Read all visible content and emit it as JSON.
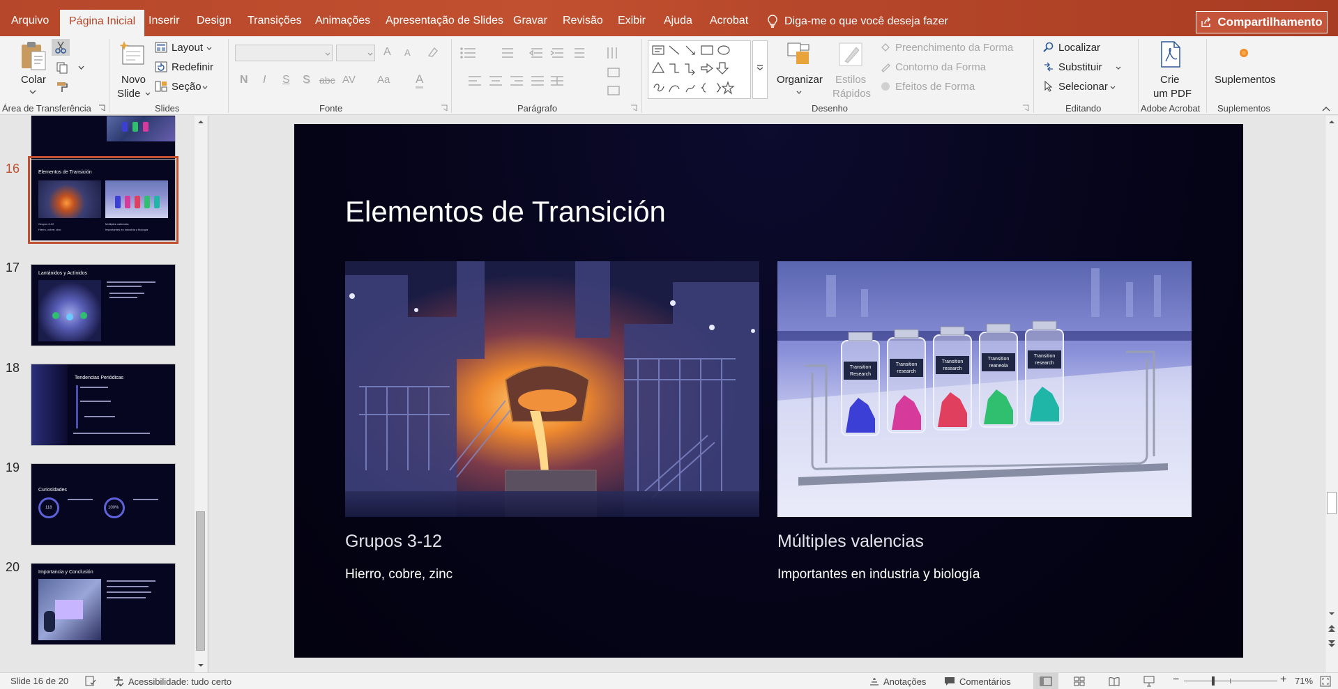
{
  "tabs": [
    {
      "label": "Arquivo",
      "active": false
    },
    {
      "label": "Página Inicial",
      "active": true
    },
    {
      "label": "Inserir",
      "active": false
    },
    {
      "label": "Design",
      "active": false
    },
    {
      "label": "Transições",
      "active": false
    },
    {
      "label": "Animações",
      "active": false
    },
    {
      "label": "Apresentação de Slides",
      "active": false
    },
    {
      "label": "Gravar",
      "active": false
    },
    {
      "label": "Revisão",
      "active": false
    },
    {
      "label": "Exibir",
      "active": false
    },
    {
      "label": "Ajuda",
      "active": false
    },
    {
      "label": "Acrobat",
      "active": false
    }
  ],
  "tell_me": "Diga-me o que você deseja fazer",
  "share_label": "Compartilhamento",
  "ribbon": {
    "clipboard": {
      "paste": "Colar",
      "group": "Área de Transferência"
    },
    "slides": {
      "new_slide_1": "Novo",
      "new_slide_2": "Slide",
      "layout": "Layout",
      "reset": "Redefinir",
      "section": "Seção",
      "group": "Slides"
    },
    "font": {
      "bold": "N",
      "italic": "I",
      "underline": "S",
      "shadow": "S",
      "strike": "abc",
      "spacing": "AV",
      "case": "Aa",
      "color": "A",
      "grow": "A",
      "shrink": "A",
      "group": "Fonte"
    },
    "paragraph": {
      "group": "Parágrafo"
    },
    "drawing": {
      "arrange": "Organizar",
      "quick_styles_1": "Estilos",
      "quick_styles_2": "Rápidos",
      "fill": "Preenchimento da Forma",
      "outline": "Contorno da Forma",
      "effects": "Efeitos de Forma",
      "group": "Desenho"
    },
    "editing": {
      "find": "Localizar",
      "replace": "Substituir",
      "select": "Selecionar",
      "group": "Editando"
    },
    "acrobat": {
      "create_1": "Crie",
      "create_2": "um PDF",
      "group": "Adobe Acrobat"
    },
    "addins": {
      "label": "Suplementos",
      "group": "Suplementos"
    }
  },
  "thumbnails": {
    "active": 16,
    "items": [
      {
        "number": "16",
        "title": "Elementos de Transición",
        "cap1": "Grupos 3-12",
        "cap1b": "Hierro, cobre, zinc",
        "cap2": "Múltiples valencias",
        "cap2b": "Importantes en industria y biología"
      },
      {
        "number": "17",
        "title": "Lantánidos y Actínidos"
      },
      {
        "number": "18",
        "title": "Tendencias Periódicas"
      },
      {
        "number": "19",
        "title": "Curiosidades",
        "stat1": "118",
        "stat2": "100%"
      },
      {
        "number": "20",
        "title": "Importancia y Conclusión"
      }
    ]
  },
  "slide": {
    "title": "Elementos de Transición",
    "left": {
      "heading": "Grupos 3-12",
      "body": "Hierro, cobre, zinc"
    },
    "right": {
      "heading": "Múltiples valencias",
      "body": "Importantes en industria y biología"
    },
    "vial_labels": [
      "Transition Research",
      "Transition research",
      "Transition research",
      "Transition reaneola",
      "Transition research"
    ],
    "vial_colors": [
      "#3b3fd6",
      "#d63a9a",
      "#e0405e",
      "#2fbf6e",
      "#1fb6a8"
    ]
  },
  "status": {
    "slide_info": "Slide 16 de 20",
    "accessibility": "Acessibilidade: tudo certo",
    "notes": "Anotações",
    "comments": "Comentários",
    "zoom": "71%"
  },
  "colors": {
    "accent": "#b7472a",
    "slide_bg": "#05041a"
  }
}
